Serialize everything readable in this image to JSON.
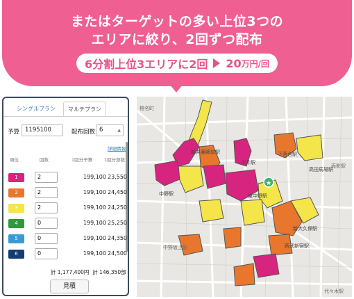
{
  "banner": {
    "headline_line1": "またはターゲットの多い上位3つの",
    "headline_line2": "エリアに絞り、2回ずつ配布",
    "pill_left": "6分割上位3エリアに2回",
    "pill_price": "20",
    "pill_unit": "万円/回",
    "colors": {
      "pink": "#ef5f92",
      "pink_text": "#e8508a"
    }
  },
  "panel": {
    "tabs": [
      "シングルプラン",
      "マルチプラン"
    ],
    "active_tab": "マルチプラン",
    "budget_label": "予算",
    "budget_value": "1195100",
    "count_label": "配布回数",
    "count_value": "6",
    "detail_link": "詳細情報",
    "columns": [
      "順位",
      "回数",
      "1回分予算",
      "1回分部数"
    ],
    "rows": [
      {
        "rank": "1",
        "color": "#d6247f",
        "times": "2",
        "budget": "199,100",
        "copies": "23,550"
      },
      {
        "rank": "2",
        "color": "#e8762d",
        "times": "2",
        "budget": "199,100",
        "copies": "24,450"
      },
      {
        "rank": "3",
        "color": "#f3e54a",
        "times": "2",
        "budget": "199,100",
        "copies": "24,250"
      },
      {
        "rank": "4",
        "color": "#2f9a3c",
        "times": "0",
        "budget": "199,100",
        "copies": "25,250"
      },
      {
        "rank": "5",
        "color": "#3a9ad4",
        "times": "0",
        "budget": "199,100",
        "copies": "24,350"
      },
      {
        "rank": "6",
        "color": "#143d73",
        "times": "0",
        "budget": "199,100",
        "copies": "24,500"
      }
    ],
    "total_label": "計",
    "total_budget": "1,177,400円",
    "total_copies": "計 146,350部",
    "quote_button": "見積"
  },
  "map": {
    "labels": [
      "椎名町",
      "新井薬師前駅",
      "下落合駅",
      "中井駅",
      "中野駅",
      "東中野駅",
      "高田馬場駅",
      "面影駅",
      "新大久保駅",
      "西武新宿駅",
      "中野坂上駅",
      "代々木駅"
    ],
    "area_colors": {
      "rank1": "#d6247f",
      "rank2": "#e8762d",
      "rank3": "#f3e54a",
      "marker": "#3fb56b"
    }
  }
}
